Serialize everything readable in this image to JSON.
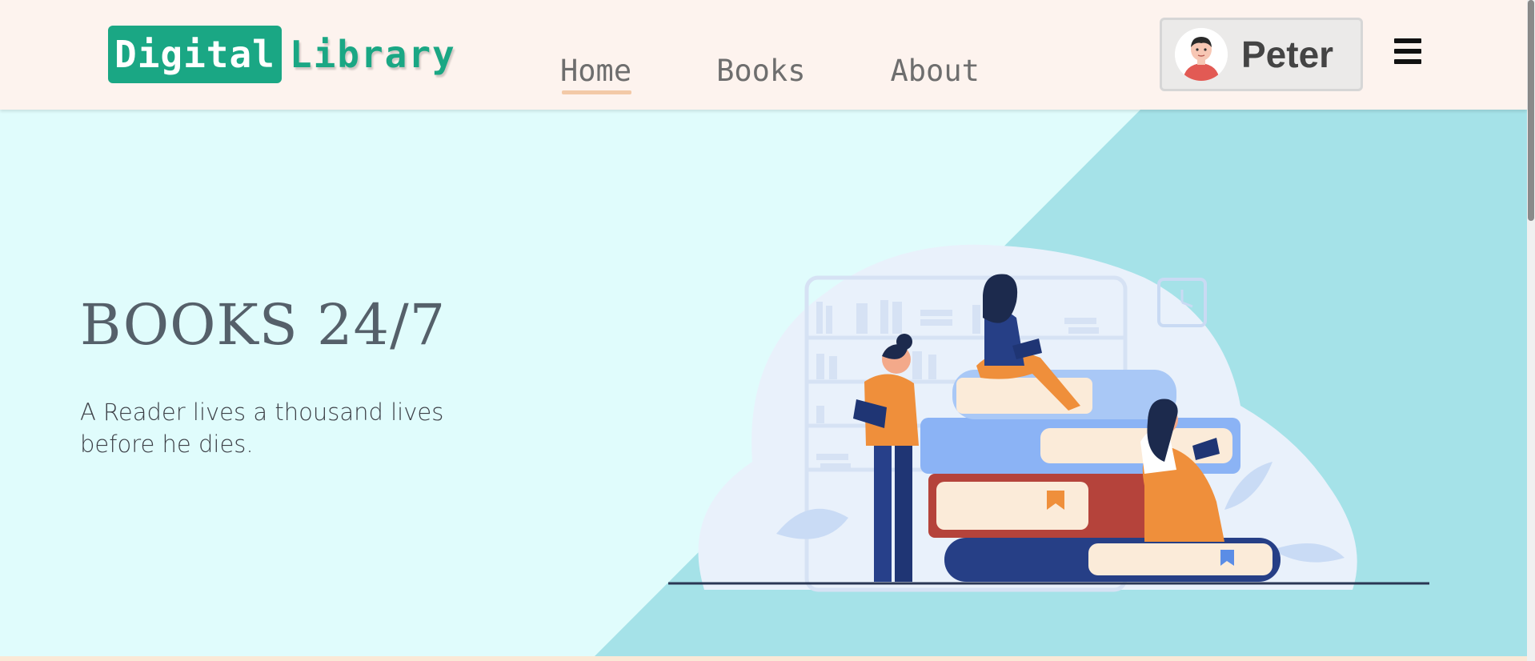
{
  "logo": {
    "part1": "Digital",
    "part2": "Library"
  },
  "nav": {
    "items": [
      "Home",
      "Books",
      "About"
    ],
    "active": "Home"
  },
  "user": {
    "name": "Peter"
  },
  "hero": {
    "title": "BOOKS 24/7",
    "subtitle": "A Reader lives a thousand lives before he dies."
  },
  "colors": {
    "header_bg": "#fdf3ee",
    "brand_green": "#1aa784",
    "hero_light": "#e0fcfc",
    "hero_dark": "#a5e2e8",
    "nav_underline": "#f3c9a7"
  },
  "icons": {
    "menu": "hamburger-icon",
    "avatar": "user-avatar-icon",
    "illustration": "reading-people-books-illustration"
  }
}
